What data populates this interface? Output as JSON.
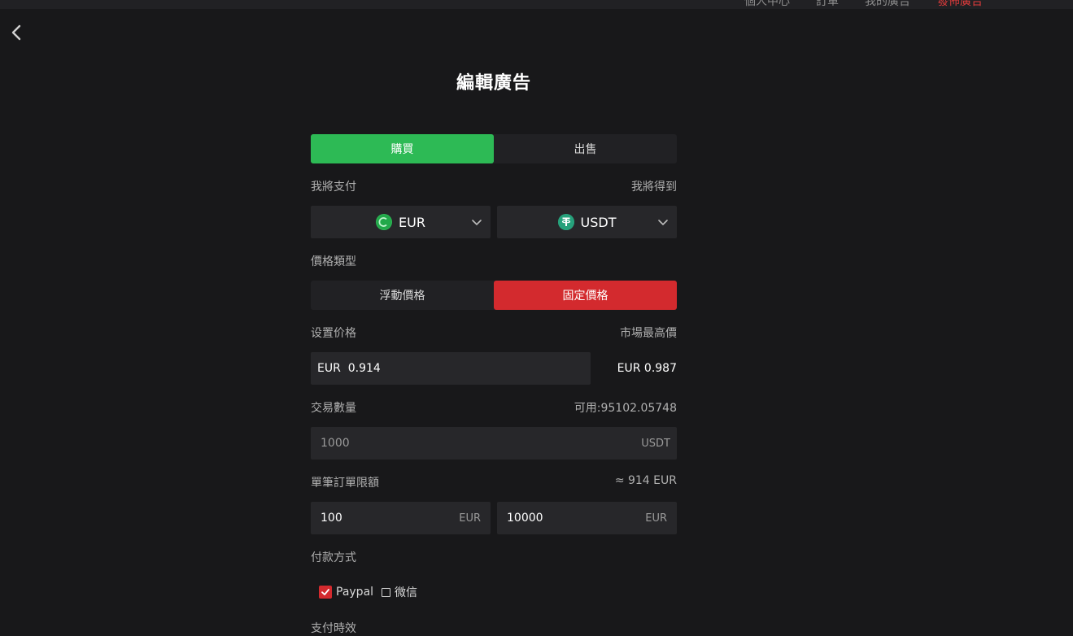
{
  "top_nav": {
    "items": [
      "個人中心",
      "訂單",
      "我的廣告",
      "發佈廣告"
    ]
  },
  "page": {
    "title": "編輯廣告"
  },
  "trade_type": {
    "buy_label": "購買",
    "sell_label": "出售",
    "selected": "購買"
  },
  "currency": {
    "pay_label": "我將支付",
    "receive_label": "我將得到",
    "pay_value": "EUR",
    "receive_value": "USDT"
  },
  "price_type": {
    "label": "價格類型",
    "floating_label": "浮動價格",
    "fixed_label": "固定價格",
    "selected": "固定價格"
  },
  "price": {
    "label": "设置价格",
    "market_label": "市場最高價",
    "value": "EUR  0.914",
    "market_value": "EUR 0.987"
  },
  "quantity": {
    "label": "交易數量",
    "available": "可用:95102.05748",
    "placeholder": "1000",
    "unit": "USDT"
  },
  "limit": {
    "label": "單筆訂單限額",
    "approx": "≈ 914 EUR",
    "min_value": "100",
    "min_unit": "EUR",
    "max_value": "10000",
    "max_unit": "EUR"
  },
  "payment": {
    "label": "付款方式",
    "options": [
      {
        "label": "Paypal",
        "checked": true
      },
      {
        "label": "微信",
        "checked": false
      }
    ]
  },
  "next_section": {
    "label": "支付時效"
  },
  "colors": {
    "buy_green": "#2dba55",
    "accent_red": "#d32a2e",
    "usdt_green": "#26a17b"
  }
}
